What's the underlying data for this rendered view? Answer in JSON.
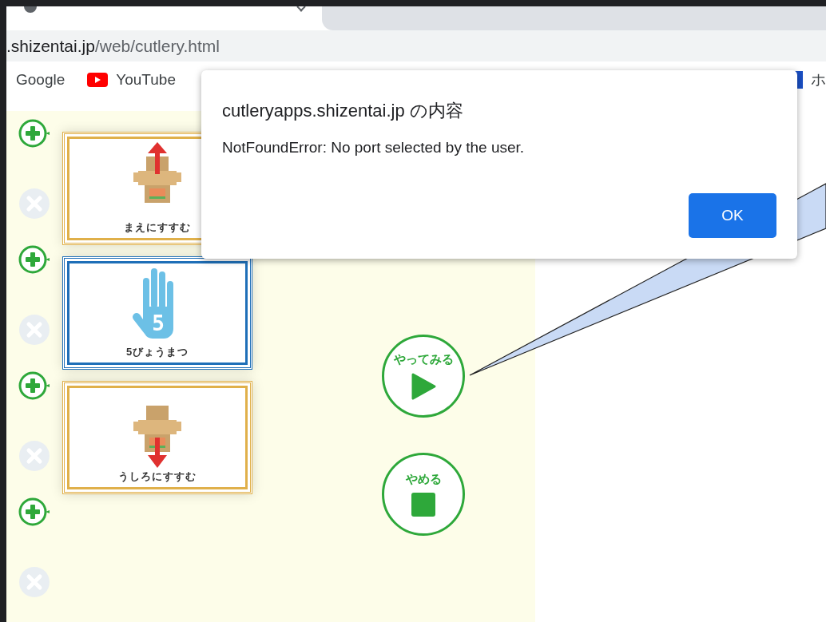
{
  "browser": {
    "address": {
      "host": ".shizentai.jp",
      "path": "/web/cutlery.html"
    },
    "bookmarks": [
      {
        "label": "Google",
        "kind": "plain"
      },
      {
        "label": "YouTube",
        "kind": "youtube"
      },
      {
        "label": "ホ",
        "kind": "folder"
      }
    ]
  },
  "program": {
    "cards": [
      {
        "label": "まえにすすむ",
        "kind": "forward"
      },
      {
        "label": "5びょうまつ",
        "kind": "wait",
        "badge": "5"
      },
      {
        "label": "うしろにすすむ",
        "kind": "backward"
      }
    ]
  },
  "controls": [
    {
      "label": "やってみる",
      "kind": "play"
    },
    {
      "label": "やめる",
      "kind": "stop"
    }
  ],
  "dialog": {
    "title": "cutleryapps.shizentai.jp の内容",
    "message": "NotFoundError: No port selected by the user.",
    "button": "OK"
  }
}
